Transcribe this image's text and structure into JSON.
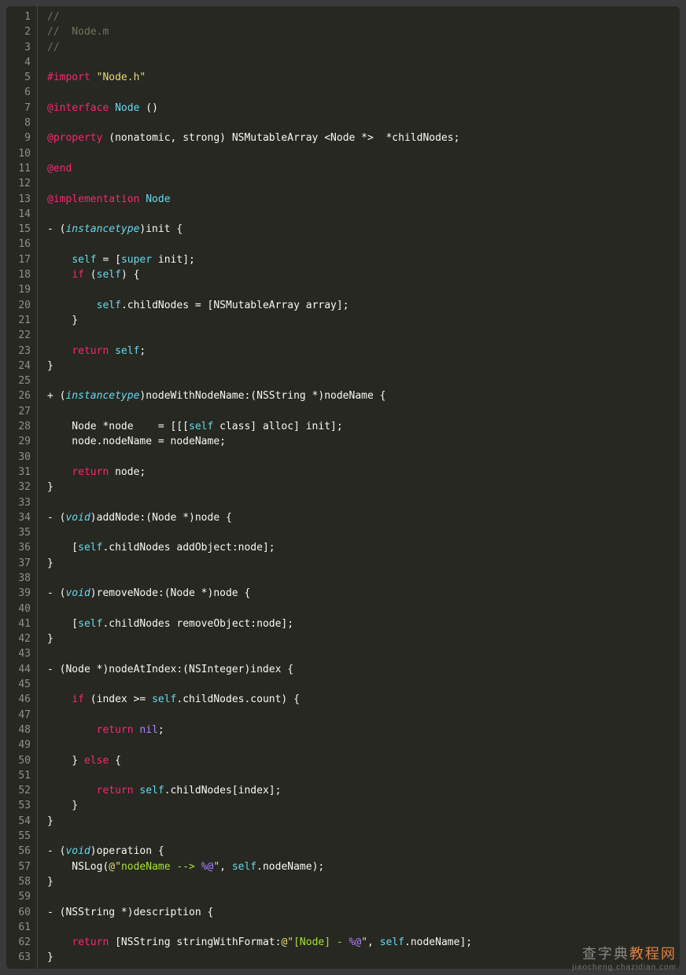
{
  "watermark": {
    "text1": "查字典",
    "text2": "教程网",
    "url": "jiaocheng.chazidian.com"
  },
  "lines": [
    {
      "n": 1,
      "tokens": [
        {
          "c": "c-comment",
          "t": "//"
        }
      ]
    },
    {
      "n": 2,
      "tokens": [
        {
          "c": "c-comment",
          "t": "//  Node.m"
        }
      ]
    },
    {
      "n": 3,
      "tokens": [
        {
          "c": "c-comment",
          "t": "//"
        }
      ]
    },
    {
      "n": 4,
      "tokens": []
    },
    {
      "n": 5,
      "tokens": [
        {
          "c": "c-keyword",
          "t": "#import"
        },
        {
          "c": "",
          "t": " "
        },
        {
          "c": "c-string",
          "t": "\"Node.h\""
        }
      ]
    },
    {
      "n": 6,
      "tokens": []
    },
    {
      "n": 7,
      "tokens": [
        {
          "c": "c-keyword",
          "t": "@interface"
        },
        {
          "c": "",
          "t": " "
        },
        {
          "c": "c-decl",
          "t": "Node"
        },
        {
          "c": "",
          "t": " ()"
        }
      ]
    },
    {
      "n": 8,
      "tokens": []
    },
    {
      "n": 9,
      "tokens": [
        {
          "c": "c-keyword",
          "t": "@property"
        },
        {
          "c": "",
          "t": " (nonatomic, strong) NSMutableArray <Node *>  *childNodes;"
        }
      ]
    },
    {
      "n": 10,
      "tokens": []
    },
    {
      "n": 11,
      "tokens": [
        {
          "c": "c-keyword",
          "t": "@end"
        }
      ]
    },
    {
      "n": 12,
      "tokens": []
    },
    {
      "n": 13,
      "tokens": [
        {
          "c": "c-keyword",
          "t": "@implementation"
        },
        {
          "c": "",
          "t": " "
        },
        {
          "c": "c-decl",
          "t": "Node"
        }
      ]
    },
    {
      "n": 14,
      "tokens": []
    },
    {
      "n": 15,
      "tokens": [
        {
          "c": "",
          "t": "- ("
        },
        {
          "c": "c-type",
          "t": "instancetype"
        },
        {
          "c": "",
          "t": ")init {"
        }
      ]
    },
    {
      "n": 16,
      "tokens": []
    },
    {
      "n": 17,
      "tokens": [
        {
          "c": "",
          "t": "    "
        },
        {
          "c": "c-self",
          "t": "self"
        },
        {
          "c": "",
          "t": " = ["
        },
        {
          "c": "c-self",
          "t": "super"
        },
        {
          "c": "",
          "t": " init];"
        }
      ]
    },
    {
      "n": 18,
      "tokens": [
        {
          "c": "",
          "t": "    "
        },
        {
          "c": "c-keyword",
          "t": "if"
        },
        {
          "c": "",
          "t": " ("
        },
        {
          "c": "c-self",
          "t": "self"
        },
        {
          "c": "",
          "t": ") {"
        }
      ]
    },
    {
      "n": 19,
      "tokens": []
    },
    {
      "n": 20,
      "tokens": [
        {
          "c": "",
          "t": "        "
        },
        {
          "c": "c-self",
          "t": "self"
        },
        {
          "c": "",
          "t": ".childNodes = [NSMutableArray array];"
        }
      ]
    },
    {
      "n": 21,
      "tokens": [
        {
          "c": "",
          "t": "    }"
        }
      ]
    },
    {
      "n": 22,
      "tokens": []
    },
    {
      "n": 23,
      "tokens": [
        {
          "c": "",
          "t": "    "
        },
        {
          "c": "c-keyword",
          "t": "return"
        },
        {
          "c": "",
          "t": " "
        },
        {
          "c": "c-self",
          "t": "self"
        },
        {
          "c": "",
          "t": ";"
        }
      ]
    },
    {
      "n": 24,
      "tokens": [
        {
          "c": "",
          "t": "}"
        }
      ]
    },
    {
      "n": 25,
      "tokens": []
    },
    {
      "n": 26,
      "tokens": [
        {
          "c": "",
          "t": "+ ("
        },
        {
          "c": "c-type",
          "t": "instancetype"
        },
        {
          "c": "",
          "t": ")nodeWithNodeName:(NSString *)nodeName {"
        }
      ]
    },
    {
      "n": 27,
      "tokens": []
    },
    {
      "n": 28,
      "tokens": [
        {
          "c": "",
          "t": "    Node *node    = [[["
        },
        {
          "c": "c-self",
          "t": "self"
        },
        {
          "c": "",
          "t": " class] alloc] init];"
        }
      ]
    },
    {
      "n": 29,
      "tokens": [
        {
          "c": "",
          "t": "    node.nodeName = nodeName;"
        }
      ]
    },
    {
      "n": 30,
      "tokens": []
    },
    {
      "n": 31,
      "tokens": [
        {
          "c": "",
          "t": "    "
        },
        {
          "c": "c-keyword",
          "t": "return"
        },
        {
          "c": "",
          "t": " node;"
        }
      ]
    },
    {
      "n": 32,
      "tokens": [
        {
          "c": "",
          "t": "}"
        }
      ]
    },
    {
      "n": 33,
      "tokens": []
    },
    {
      "n": 34,
      "tokens": [
        {
          "c": "",
          "t": "- ("
        },
        {
          "c": "c-type",
          "t": "void"
        },
        {
          "c": "",
          "t": ")addNode:(Node *)node {"
        }
      ]
    },
    {
      "n": 35,
      "tokens": []
    },
    {
      "n": 36,
      "tokens": [
        {
          "c": "",
          "t": "    ["
        },
        {
          "c": "c-self",
          "t": "self"
        },
        {
          "c": "",
          "t": ".childNodes addObject:node];"
        }
      ]
    },
    {
      "n": 37,
      "tokens": [
        {
          "c": "",
          "t": "}"
        }
      ]
    },
    {
      "n": 38,
      "tokens": []
    },
    {
      "n": 39,
      "tokens": [
        {
          "c": "",
          "t": "- ("
        },
        {
          "c": "c-type",
          "t": "void"
        },
        {
          "c": "",
          "t": ")removeNode:(Node *)node {"
        }
      ]
    },
    {
      "n": 40,
      "tokens": []
    },
    {
      "n": 41,
      "tokens": [
        {
          "c": "",
          "t": "    ["
        },
        {
          "c": "c-self",
          "t": "self"
        },
        {
          "c": "",
          "t": ".childNodes removeObject:node];"
        }
      ]
    },
    {
      "n": 42,
      "tokens": [
        {
          "c": "",
          "t": "}"
        }
      ]
    },
    {
      "n": 43,
      "tokens": []
    },
    {
      "n": 44,
      "tokens": [
        {
          "c": "",
          "t": "- (Node *)nodeAtIndex:(NSInteger)index {"
        }
      ]
    },
    {
      "n": 45,
      "tokens": []
    },
    {
      "n": 46,
      "tokens": [
        {
          "c": "",
          "t": "    "
        },
        {
          "c": "c-keyword",
          "t": "if"
        },
        {
          "c": "",
          "t": " (index >= "
        },
        {
          "c": "c-self",
          "t": "self"
        },
        {
          "c": "",
          "t": ".childNodes.count) {"
        }
      ]
    },
    {
      "n": 47,
      "tokens": []
    },
    {
      "n": 48,
      "tokens": [
        {
          "c": "",
          "t": "        "
        },
        {
          "c": "c-keyword",
          "t": "return"
        },
        {
          "c": "",
          "t": " "
        },
        {
          "c": "c-num",
          "t": "nil"
        },
        {
          "c": "",
          "t": ";"
        }
      ]
    },
    {
      "n": 49,
      "tokens": []
    },
    {
      "n": 50,
      "tokens": [
        {
          "c": "",
          "t": "    } "
        },
        {
          "c": "c-keyword",
          "t": "else"
        },
        {
          "c": "",
          "t": " {"
        }
      ]
    },
    {
      "n": 51,
      "tokens": []
    },
    {
      "n": 52,
      "tokens": [
        {
          "c": "",
          "t": "        "
        },
        {
          "c": "c-keyword",
          "t": "return"
        },
        {
          "c": "",
          "t": " "
        },
        {
          "c": "c-self",
          "t": "self"
        },
        {
          "c": "",
          "t": ".childNodes[index];"
        }
      ]
    },
    {
      "n": 53,
      "tokens": [
        {
          "c": "",
          "t": "    }"
        }
      ]
    },
    {
      "n": 54,
      "tokens": [
        {
          "c": "",
          "t": "}"
        }
      ]
    },
    {
      "n": 55,
      "tokens": []
    },
    {
      "n": 56,
      "tokens": [
        {
          "c": "",
          "t": "- ("
        },
        {
          "c": "c-type",
          "t": "void"
        },
        {
          "c": "",
          "t": ")operation {"
        }
      ]
    },
    {
      "n": 57,
      "tokens": [
        {
          "c": "",
          "t": "    NSLog("
        },
        {
          "c": "c-string",
          "t": "@\""
        },
        {
          "c": "c-name",
          "t": "nodeName --> "
        },
        {
          "c": "c-num",
          "t": "%@"
        },
        {
          "c": "c-string",
          "t": "\""
        },
        {
          "c": "",
          "t": ", "
        },
        {
          "c": "c-self",
          "t": "self"
        },
        {
          "c": "",
          "t": ".nodeName);"
        }
      ]
    },
    {
      "n": 58,
      "tokens": [
        {
          "c": "",
          "t": "}"
        }
      ]
    },
    {
      "n": 59,
      "tokens": []
    },
    {
      "n": 60,
      "tokens": [
        {
          "c": "",
          "t": "- (NSString *)description {"
        }
      ]
    },
    {
      "n": 61,
      "tokens": []
    },
    {
      "n": 62,
      "tokens": [
        {
          "c": "",
          "t": "    "
        },
        {
          "c": "c-keyword",
          "t": "return"
        },
        {
          "c": "",
          "t": " [NSString stringWithFormat:"
        },
        {
          "c": "c-string",
          "t": "@\""
        },
        {
          "c": "c-name",
          "t": "[Node] - "
        },
        {
          "c": "c-num",
          "t": "%@"
        },
        {
          "c": "c-string",
          "t": "\""
        },
        {
          "c": "",
          "t": ", "
        },
        {
          "c": "c-self",
          "t": "self"
        },
        {
          "c": "",
          "t": ".nodeName];"
        }
      ]
    },
    {
      "n": 63,
      "tokens": [
        {
          "c": "",
          "t": "}"
        }
      ]
    }
  ]
}
